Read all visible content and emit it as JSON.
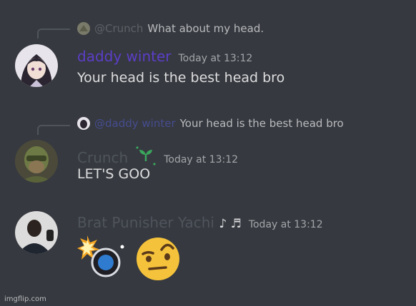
{
  "messages": [
    {
      "reply": {
        "mention": "@Crunch",
        "text": "What about my head."
      },
      "username": "daddy winter",
      "username_color": "#5865f2",
      "timestamp": "Today at 13:12",
      "content": "Your head is the best head bro",
      "avatar_icon": "anime-avatar"
    },
    {
      "reply": {
        "mention": "@daddy winter",
        "text": "Your head is the best head bro"
      },
      "username": "Crunch",
      "username_color": "#4f545c",
      "timestamp": "Today at 13:12",
      "content": "LET'S GOO",
      "avatar_icon": "soldier-avatar",
      "badge_icon": "sprout-icon"
    },
    {
      "username": "Brat Punisher Yachi",
      "username_suffix": "♪ ♬",
      "username_color": "#4f545c",
      "timestamp": "Today at 13:12",
      "avatar_icon": "person-avatar",
      "emojis": [
        "collision-ball-emoji",
        "raised-eyebrow-emoji"
      ]
    }
  ],
  "watermark": "imgflip.com"
}
